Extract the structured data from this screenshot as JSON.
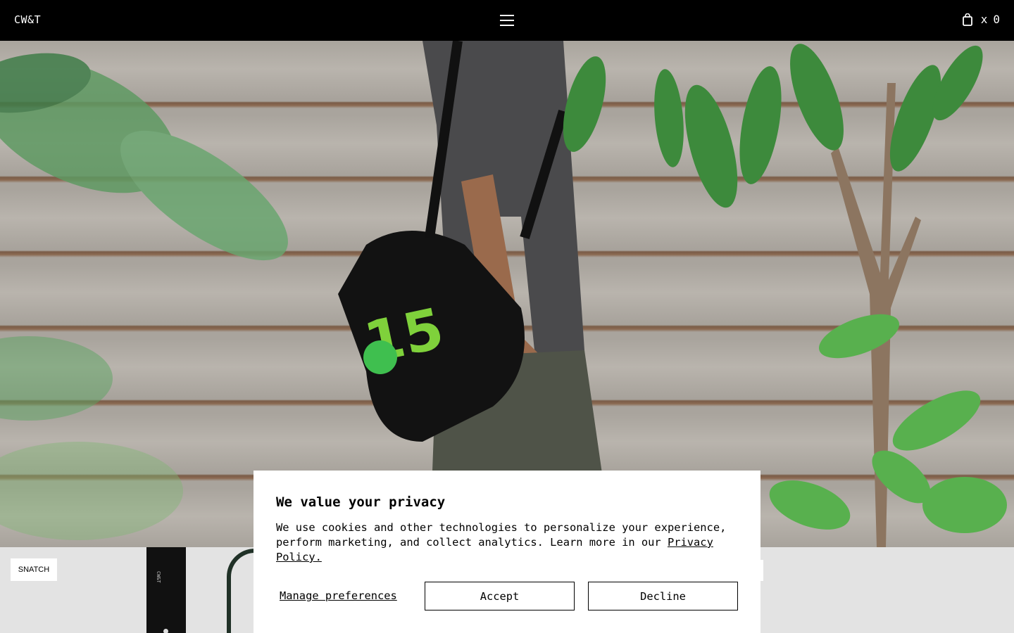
{
  "header": {
    "logo": "CW&T",
    "menu_icon": "hamburger-menu-icon",
    "cart_icon": "shopping-bag-icon",
    "cart_prefix": "x",
    "cart_count": "0"
  },
  "hero": {
    "bag_print": "15",
    "alt": ""
  },
  "product_strip": {
    "tag_label": "SNATCH",
    "strap_text": "CW&T"
  },
  "cookie_banner": {
    "title": "We value your privacy",
    "body": "We use cookies and other technologies to personalize your experience, perform marketing, and collect analytics. Learn more in our ",
    "privacy_link": "Privacy Policy.",
    "manage_label": "Manage preferences",
    "accept_label": "Accept",
    "decline_label": "Decline"
  },
  "colors": {
    "header_bg": "#000000",
    "accent_green": "#7fd13b",
    "strip_bg": "#e3e3e3"
  }
}
